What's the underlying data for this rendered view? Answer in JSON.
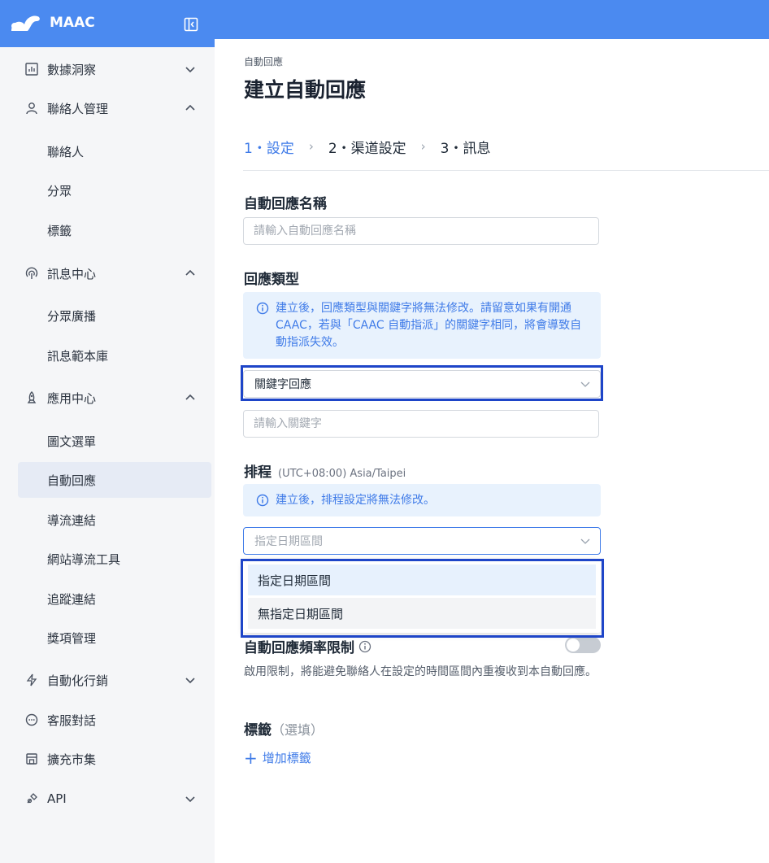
{
  "brand": {
    "name": "MAAC"
  },
  "sidebar": {
    "items": [
      {
        "label": "數據洞察"
      },
      {
        "label": "聯絡人管理"
      },
      {
        "label": "訊息中心"
      },
      {
        "label": "應用中心"
      },
      {
        "label": "自動化行銷"
      },
      {
        "label": "客服對話"
      },
      {
        "label": "擴充市集"
      },
      {
        "label": "API"
      }
    ],
    "contacts_sub": [
      {
        "label": "聯絡人"
      },
      {
        "label": "分眾"
      },
      {
        "label": "標籤"
      }
    ],
    "message_sub": [
      {
        "label": "分眾廣播"
      },
      {
        "label": "訊息範本庫"
      }
    ],
    "app_sub": [
      {
        "label": "圖文選單"
      },
      {
        "label": "自動回應"
      },
      {
        "label": "導流連結"
      },
      {
        "label": "網站導流工具"
      },
      {
        "label": "追蹤連結"
      },
      {
        "label": "獎項管理"
      }
    ]
  },
  "main": {
    "breadcrumb": "自動回應",
    "title": "建立自動回應",
    "steps": [
      {
        "label": "1・設定"
      },
      {
        "label": "2・渠道設定"
      },
      {
        "label": "3・訊息"
      }
    ],
    "step_separator": "›",
    "name_field": {
      "label": "自動回應名稱",
      "placeholder": "請輸入自動回應名稱"
    },
    "reply_type": {
      "label": "回應類型",
      "info": "建立後，回應類型與關鍵字將無法修改。請留意如果有開通 CAAC，若與「CAAC 自動指派」的關鍵字相同，將會導致自動指派失效。",
      "selected": "關鍵字回應",
      "keyword_placeholder": "請輸入關鍵字"
    },
    "schedule": {
      "label": "排程",
      "timezone": "(UTC+08:00) Asia/Taipei",
      "info": "建立後，排程設定將無法修改。",
      "placeholder": "指定日期區間",
      "options": [
        "指定日期區間",
        "無指定日期區間"
      ]
    },
    "frequency": {
      "label": "自動回應頻率限制",
      "enabled": false,
      "help": "啟用限制，將能避免聯絡人在設定的時間區間內重複收到本自動回應。"
    },
    "tags": {
      "label": "標籤",
      "optional": "（選填）",
      "add_label": "增加標籤"
    }
  },
  "colors": {
    "primary": "#4b8af0",
    "accent": "#3f7be8",
    "highlight": "#1e45c8",
    "info_bg": "#e8f2fd"
  }
}
